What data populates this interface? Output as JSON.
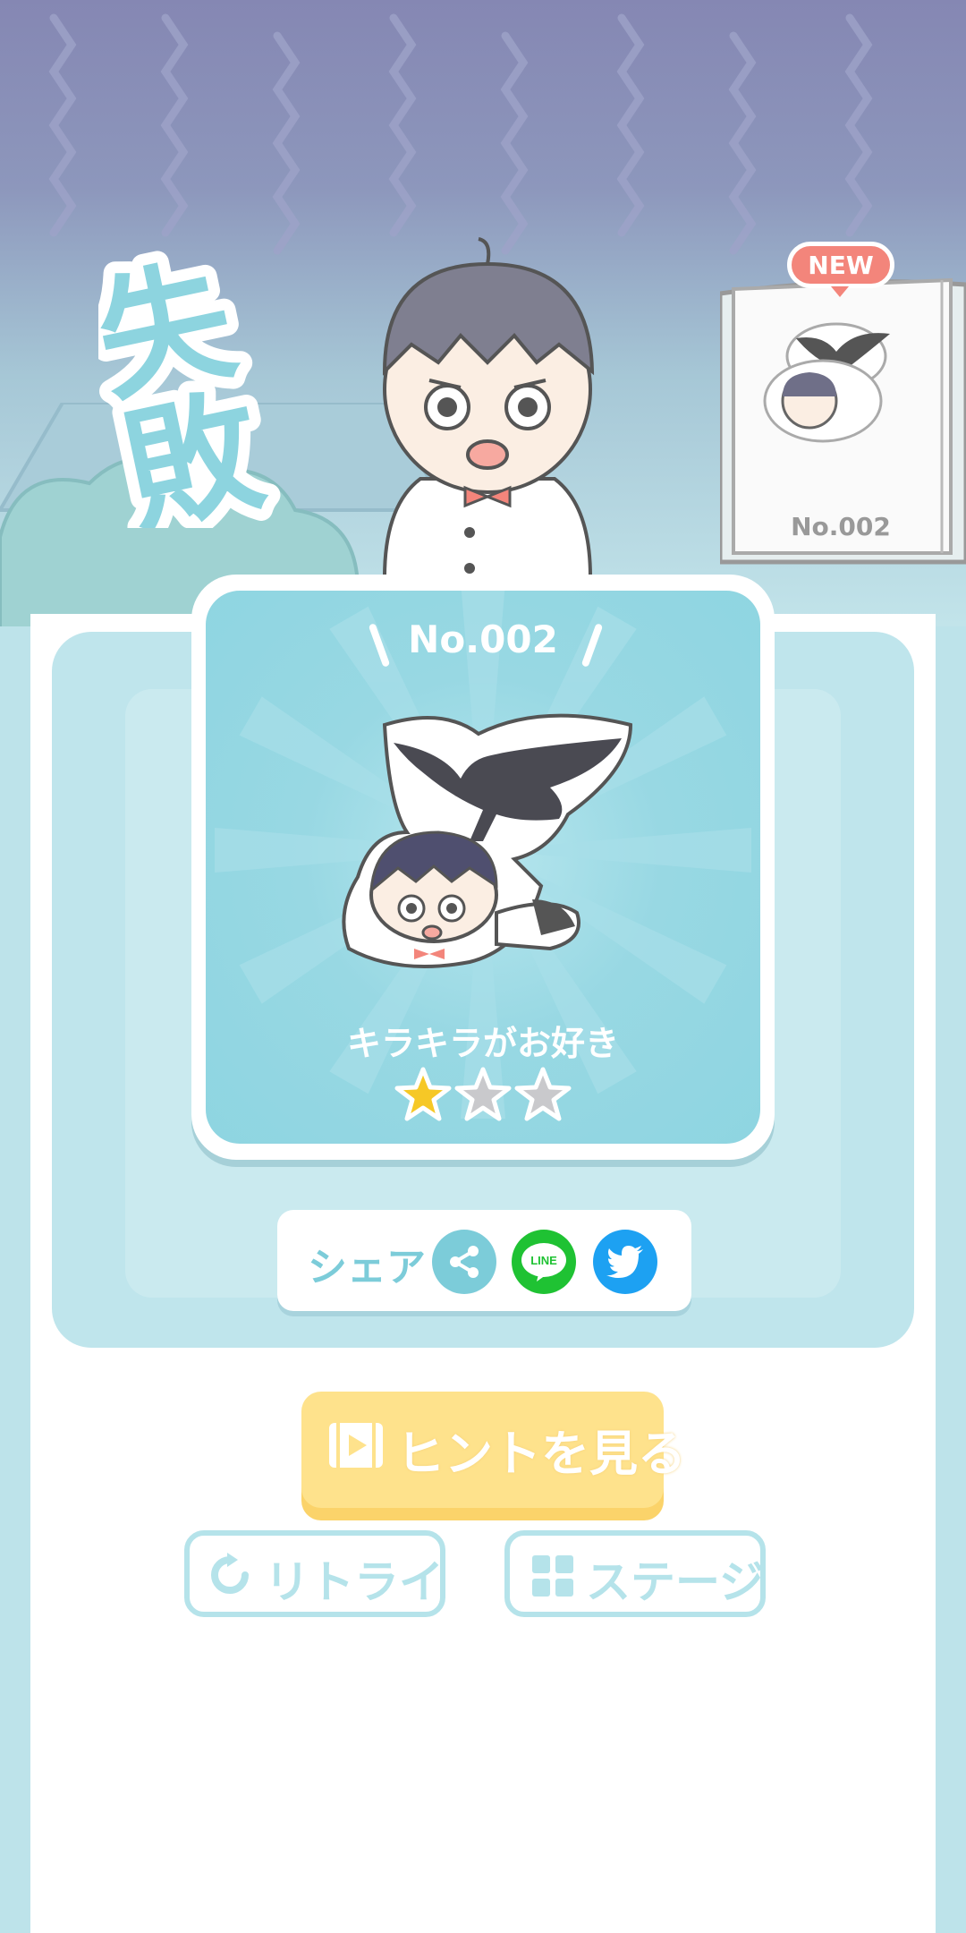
{
  "result": {
    "title": "失敗…"
  },
  "collection": {
    "new_badge": "NEW",
    "number": "No.002"
  },
  "card": {
    "number": "No.002",
    "title": "キラキラがお好き",
    "stars_earned": 1,
    "stars_total": 3
  },
  "share": {
    "label": "シェア",
    "line_label": "LINE"
  },
  "buttons": {
    "hint": "ヒントを見る",
    "retry": "リトライ",
    "stage": "ステージ"
  },
  "colors": {
    "accent": "#7cccd9",
    "hint_button": "#fee28c",
    "line": "#1fc233",
    "twitter": "#1da1f2",
    "star": "#f6c826",
    "new_badge": "#f3857b"
  }
}
